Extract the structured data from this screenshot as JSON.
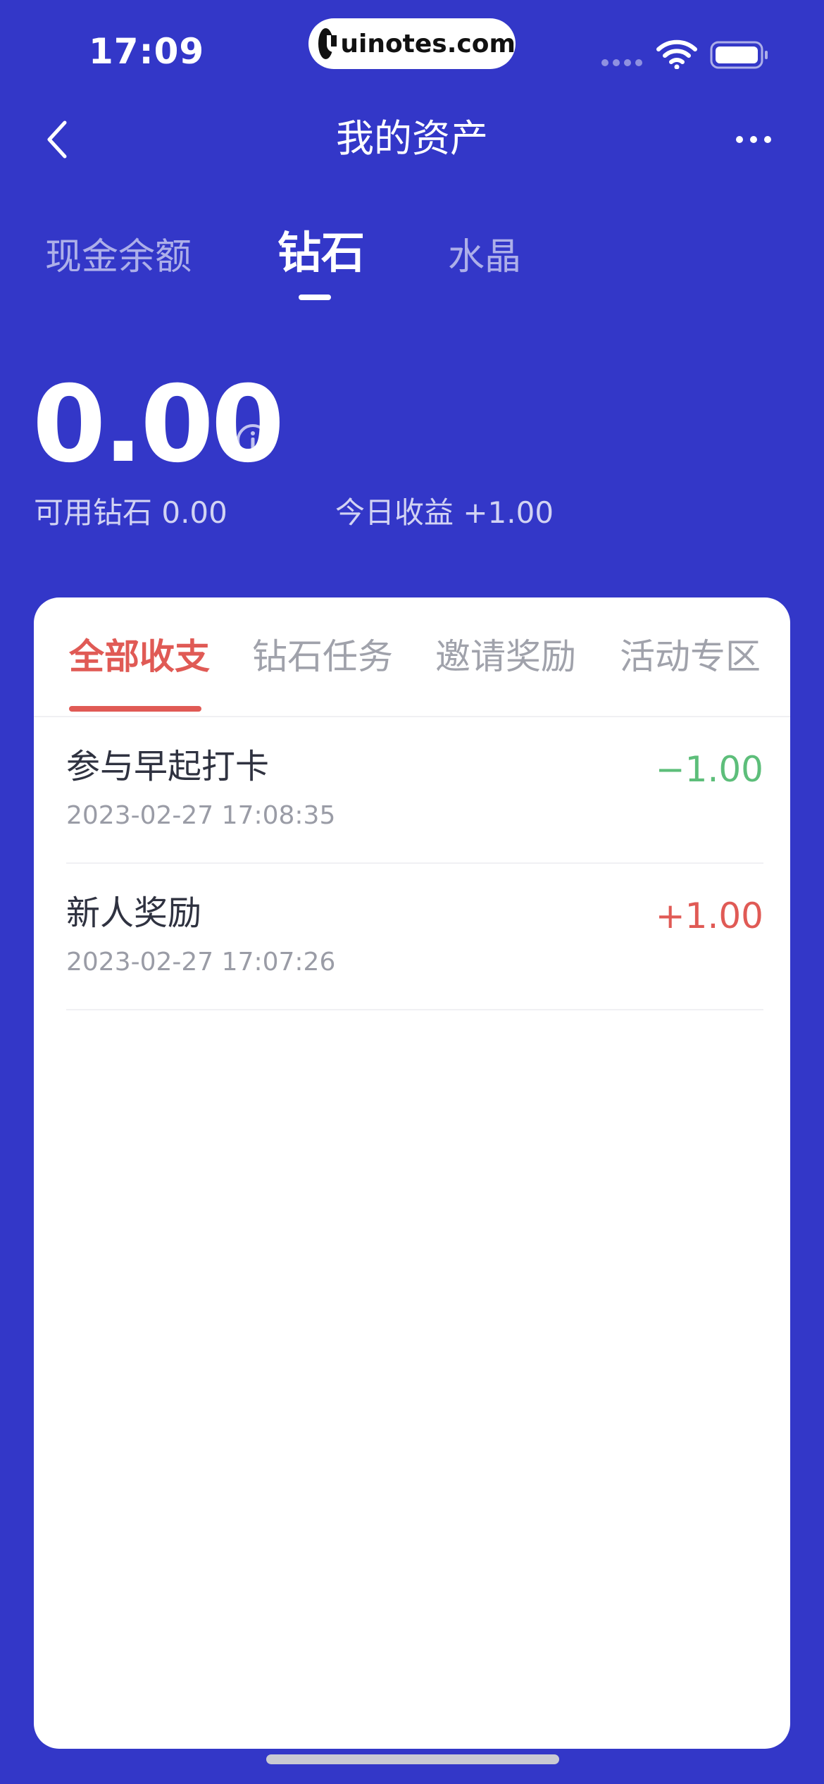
{
  "status_bar": {
    "time": "17:09",
    "watermark": "uinotes.com"
  },
  "nav": {
    "title": "我的资产"
  },
  "asset_tabs": [
    {
      "label": "现金余额",
      "active": false
    },
    {
      "label": "钻石",
      "active": true
    },
    {
      "label": "水晶",
      "active": false
    }
  ],
  "balance": {
    "value": "0.00",
    "available": "可用钻石 0.00",
    "today": "今日收益 +1.00"
  },
  "record_tabs": [
    {
      "label": "全部收支",
      "active": true
    },
    {
      "label": "钻石任务",
      "active": false
    },
    {
      "label": "邀请奖励",
      "active": false
    },
    {
      "label": "活动专区",
      "active": false
    }
  ],
  "records": [
    {
      "title": "参与早起打卡",
      "time": "2023-02-27 17:08:35",
      "amount": "−1.00",
      "color": "#5DBE7A"
    },
    {
      "title": "新人奖励",
      "time": "2023-02-27 17:07:26",
      "amount": "+1.00",
      "color": "#E05A55"
    }
  ],
  "colors": {
    "background": "#3337C8",
    "accent_red": "#E05A55",
    "accent_green": "#5DBE7A"
  }
}
